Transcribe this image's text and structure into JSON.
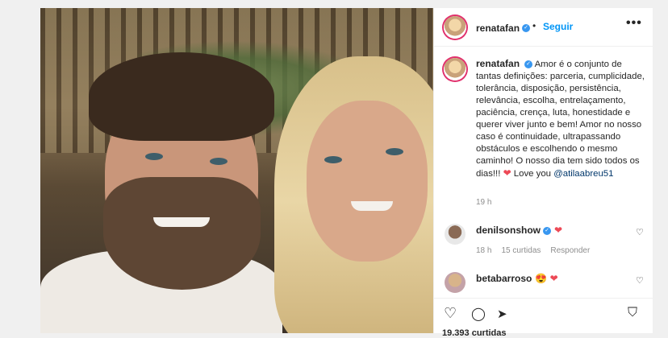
{
  "post": {
    "username": "renatafan",
    "follow_label": "Seguir",
    "separator": "•",
    "more_label": "•••",
    "verified_mark": "✓",
    "caption_text": "Amor é o conjunto de tantas definições: parceria, cumplicidade, tolerância, disposição, persistência, relevância, escolha, entrelaçamento, paciência, crença, luta, honestidade e querer viver junto e bem! Amor no nosso caso é continuidade, ultrapassando obstáculos e escolhendo o mesmo caminho! O nosso dia tem sido todos os dias!!! ",
    "caption_heart": "❤",
    "caption_love": " Love you ",
    "caption_mention": "@atilaabreu51",
    "time_ago": "19 h",
    "carousel_next": "›"
  },
  "comments": [
    {
      "username": "denilsonshow",
      "text": "❤",
      "time_ago": "18 h",
      "likes": "15 curtidas",
      "reply_label": "Responder",
      "like_icon": "♡"
    },
    {
      "username": "betabarroso",
      "text": "😍 ❤",
      "like_icon": "♡"
    }
  ],
  "actions": {
    "like_icon": "♡",
    "comment_icon": "◯",
    "share_icon": "➤",
    "save_icon": "⛉"
  },
  "likes_count": "19.393 curtidas",
  "colors": {
    "accent": "#0095f6",
    "verified": "#3897f0",
    "heart": "#ed4956",
    "ring": "#e1306c"
  }
}
